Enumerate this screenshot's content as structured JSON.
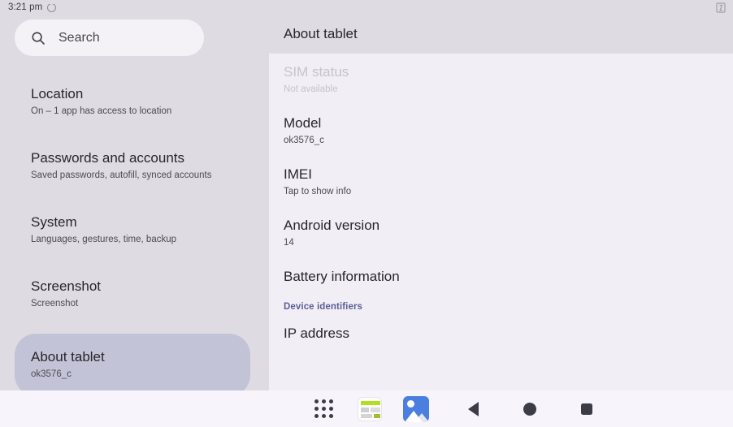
{
  "status_bar": {
    "time": "3:21 pm",
    "left_icon": "circle-indicator-icon",
    "right_icon": "cast-screen-icon"
  },
  "search": {
    "placeholder": "Search",
    "icon": "search-icon"
  },
  "sidebar": {
    "items": [
      {
        "title": "Location",
        "subtitle": "On – 1 app has access to location",
        "selected": false
      },
      {
        "title": "Passwords and accounts",
        "subtitle": "Saved passwords, autofill, synced accounts",
        "selected": false
      },
      {
        "title": "System",
        "subtitle": "Languages, gestures, time, backup",
        "selected": false
      },
      {
        "title": "Screenshot",
        "subtitle": "Screenshot",
        "selected": false
      },
      {
        "title": "About tablet",
        "subtitle": "ok3576_c",
        "selected": true
      }
    ]
  },
  "detail": {
    "title": "About tablet",
    "rows": [
      {
        "title": "SIM status",
        "subtitle": "Not available",
        "disabled": true
      },
      {
        "title": "Model",
        "subtitle": "ok3576_c",
        "disabled": false
      },
      {
        "title": "IMEI",
        "subtitle": "Tap to show info",
        "disabled": false
      },
      {
        "title": "Android version",
        "subtitle": "14",
        "disabled": false
      },
      {
        "title": "Battery information",
        "subtitle": "",
        "disabled": false
      }
    ],
    "section_link": "Device identifiers",
    "trailing_rows": [
      {
        "title": "IP address",
        "subtitle": "",
        "disabled": false
      }
    ]
  },
  "taskbar": {
    "buttons": [
      {
        "name": "app-drawer",
        "icon": "apps-grid-icon"
      },
      {
        "name": "app-shortcut-settings",
        "icon": "app-card-icon"
      },
      {
        "name": "app-shortcut-gallery",
        "icon": "gallery-photos-icon"
      },
      {
        "name": "back",
        "icon": "back-triangle-icon"
      },
      {
        "name": "home",
        "icon": "home-circle-icon"
      },
      {
        "name": "recents",
        "icon": "recents-square-icon"
      }
    ]
  },
  "colors": {
    "sidebar_bg": "#dedce2",
    "detail_bg": "#f1eff5",
    "selected_pill": "#c3c3d8",
    "taskbar_bg": "#f8f4fb",
    "link": "#5c5e99",
    "gallery_blue": "#4a7fe0",
    "app_icon_green": "#b2e01e"
  }
}
